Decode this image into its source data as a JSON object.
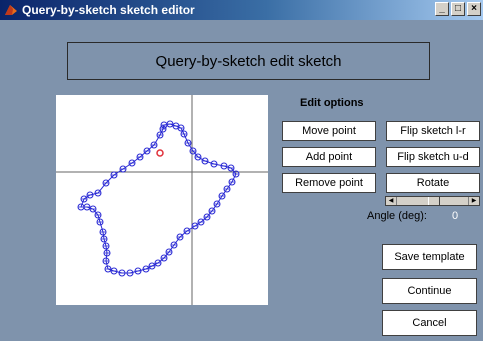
{
  "window": {
    "title": "Query-by-sketch sketch editor",
    "controls": [
      "_",
      "□",
      "×"
    ]
  },
  "header": {
    "title": "Query-by-sketch edit sketch"
  },
  "edit_options": {
    "label": "Edit options",
    "move_point": "Move point",
    "add_point": "Add point",
    "remove_point": "Remove point",
    "flip_lr": "Flip sketch l-r",
    "flip_ud": "Flip sketch u-d",
    "rotate": "Rotate"
  },
  "angle": {
    "label": "Angle (deg):",
    "value": "0",
    "slider_fraction": 0.5
  },
  "actions": {
    "save_template": "Save template",
    "continue": "Continue",
    "cancel": "Cancel"
  },
  "colors": {
    "background": "#7f93ac",
    "sketch_line": "#2a2ad4",
    "selected_point": "#e0303a",
    "crosshair": "#666666"
  }
}
